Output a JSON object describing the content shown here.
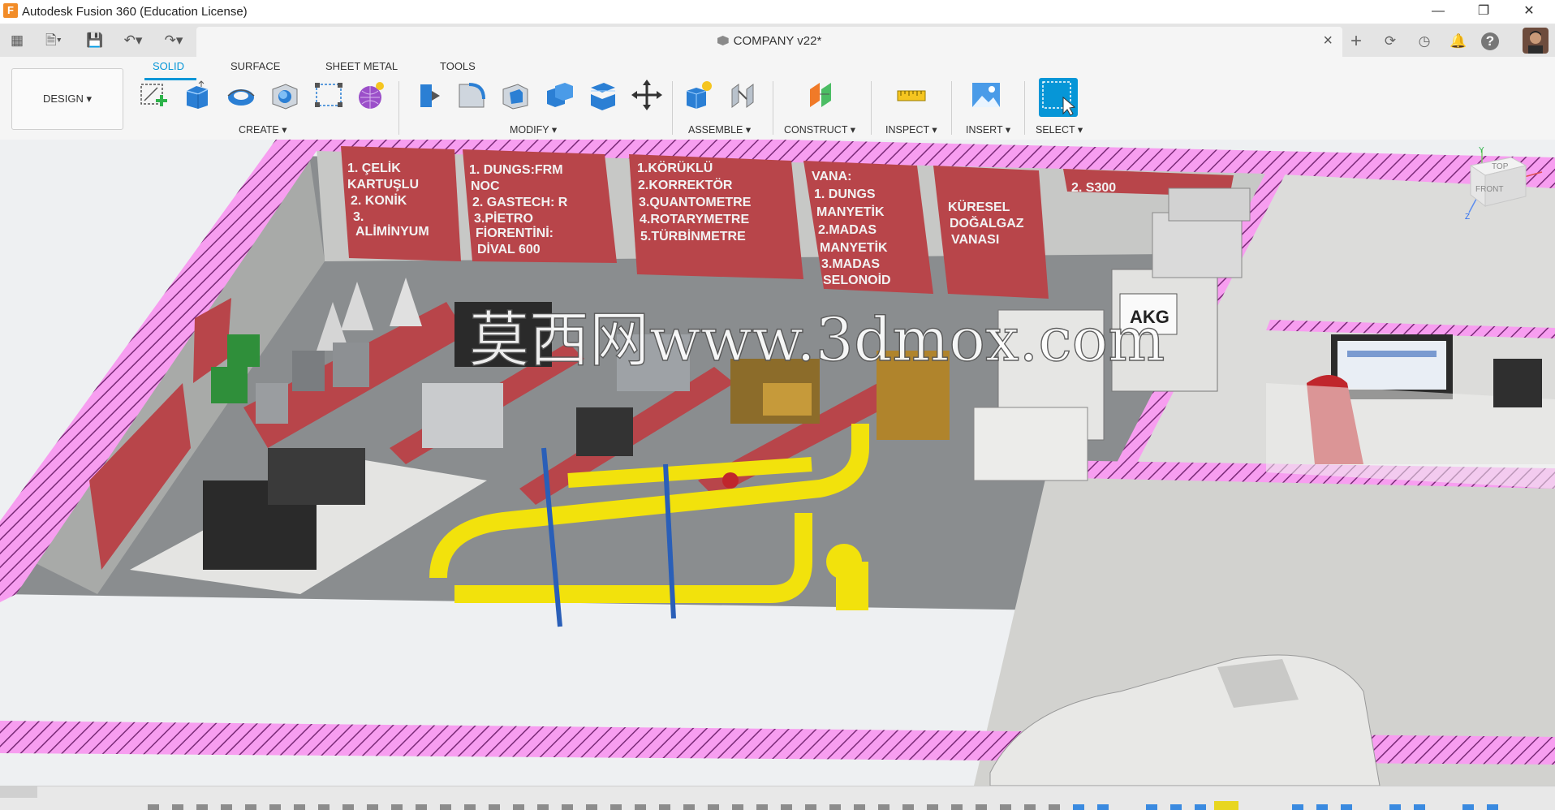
{
  "app": {
    "title": "Autodesk Fusion 360 (Education License)",
    "icon_letter": "F"
  },
  "window_controls": {
    "minimize": "—",
    "restore": "❐",
    "close": "✕"
  },
  "quick_access": {
    "grid": "▦",
    "file": "🗎▾",
    "save": "💾",
    "undo": "↶▾",
    "redo": "↷▾"
  },
  "document": {
    "title": "COMPANY v22*",
    "close": "×"
  },
  "header_icons": {
    "new_tab": "+",
    "extensions": "⟳",
    "job_status": "◷",
    "notifications": "🔔",
    "help": "?"
  },
  "workspace": {
    "label": "DESIGN ▾"
  },
  "ribbon": {
    "tabs": [
      "SOLID",
      "SURFACE",
      "SHEET METAL",
      "TOOLS"
    ],
    "groups": {
      "create": "CREATE ▾",
      "modify": "MODIFY ▾",
      "assemble": "ASSEMBLE ▾",
      "construct": "CONSTRUCT ▾",
      "inspect": "INSPECT ▾",
      "insert": "INSERT ▾",
      "select": "SELECT ▾"
    }
  },
  "signs": [
    [
      "1. ÇELİK",
      "KARTUŞLU",
      "2. KONİK",
      "3.",
      "ALİMİNYUM"
    ],
    [
      "1. DUNGS:FRM",
      "NOC",
      "2. GASTECH: R",
      "3.PİETRO",
      "FİORENTİNİ:",
      "DİVAL 600"
    ],
    [
      "1.KÖRÜKLÜ",
      "2.KORREKTÖR",
      "3.QUANTOMETRE",
      "4.ROTARYMETRE",
      "5.TÜRBİNMETRE"
    ],
    [
      "VANA:",
      "1. DUNGS",
      "MANYETİK",
      "2.MADAS",
      "MANYETİK",
      "3.MADAS",
      "SELONOİD"
    ],
    [
      "KÜRESEL",
      "DOĞALGAZ",
      "VANASI"
    ],
    [
      "2. S300"
    ]
  ],
  "cabinet_label": "AKG",
  "watermark": "莫西网www.3dmox.com",
  "viewcube": {
    "top": "TOP",
    "front": "FRONT",
    "y_axis": "Y",
    "z_axis": "Z"
  },
  "colors": {
    "accent": "#0696d7",
    "hatch_pink": "#f07ae6",
    "sign_red": "#b8454a",
    "pipe_yellow": "#f2e20c"
  }
}
